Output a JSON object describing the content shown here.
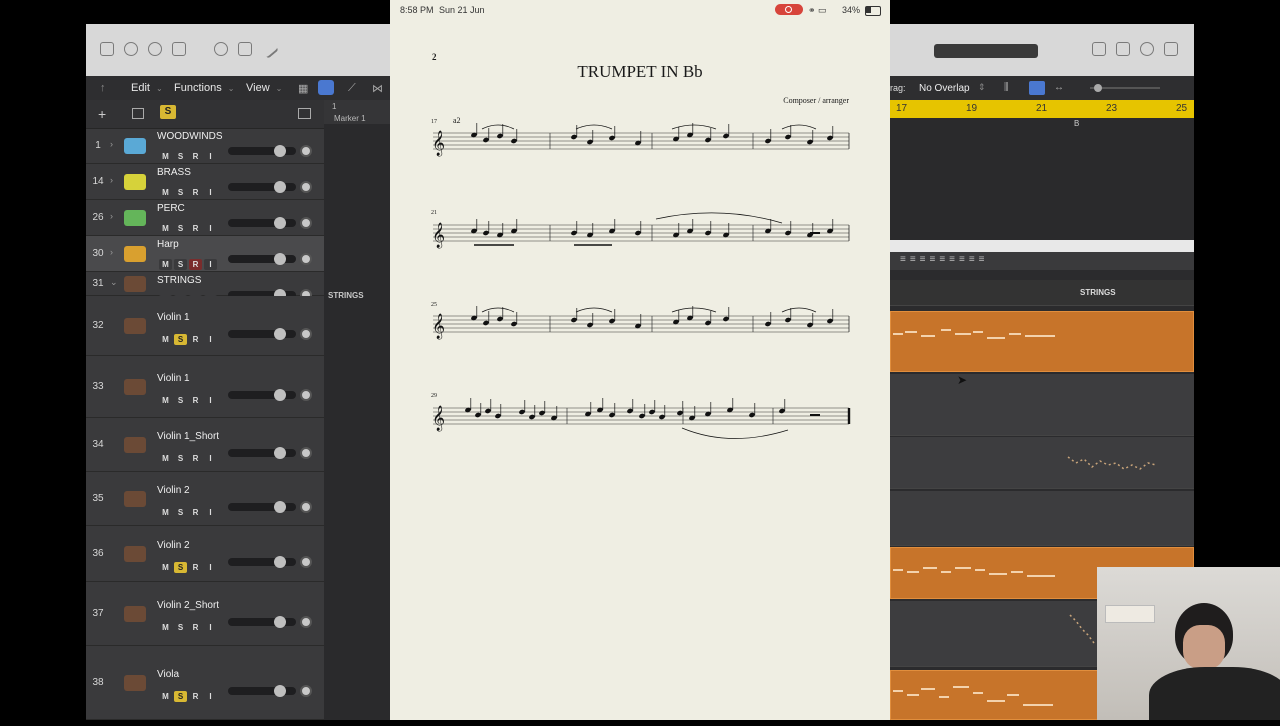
{
  "ipad_status": {
    "time": "8:58 PM",
    "date": "Sun 21 Jun",
    "battery": "34%"
  },
  "score": {
    "page_number": "2",
    "title": "TRUMPET IN Bb",
    "composer": "Composer / arranger",
    "systems": [
      {
        "measure": "17",
        "marking": "a2"
      },
      {
        "measure": "21"
      },
      {
        "measure": "25"
      },
      {
        "measure": "29"
      }
    ]
  },
  "logic": {
    "menus": {
      "edit": "Edit",
      "functions": "Functions",
      "view": "View"
    },
    "marker": "Marker 1",
    "drag_label": "rag:",
    "drag_value": "No Overlap",
    "ruler_numbers": [
      "17",
      "19",
      "21",
      "23",
      "25"
    ],
    "ruler_marker": "B",
    "folder_label": "STRINGS",
    "solo_badge": "S",
    "tracks": [
      {
        "num": "1",
        "name": "WOODWINDS",
        "m": "M",
        "s": "S",
        "r": "R",
        "i": "I",
        "color": "#5aa9d6"
      },
      {
        "num": "14",
        "name": "BRASS",
        "m": "M",
        "s": "S",
        "r": "R",
        "i": "I",
        "color": "#d6d23a"
      },
      {
        "num": "26",
        "name": "PERC",
        "m": "M",
        "s": "S",
        "r": "R",
        "i": "I",
        "color": "#64b55a"
      },
      {
        "num": "30",
        "name": "Harp",
        "m": "M",
        "s": "S",
        "r": "R",
        "i": "I",
        "color": "#d9a02f"
      },
      {
        "num": "31",
        "name": "STRINGS",
        "m": "M",
        "s": "S",
        "r": "R",
        "i": "I",
        "color": "#6b4a36"
      },
      {
        "num": "32",
        "name": "Violin 1",
        "m": "M",
        "s": "S",
        "r": "R",
        "i": "I",
        "color": "#6b4a36"
      },
      {
        "num": "33",
        "name": "Violin 1",
        "m": "M",
        "s": "S",
        "r": "R",
        "i": "I",
        "color": "#6b4a36"
      },
      {
        "num": "34",
        "name": "Violin 1_Short",
        "m": "M",
        "s": "S",
        "r": "R",
        "i": "I",
        "color": "#6b4a36"
      },
      {
        "num": "35",
        "name": "Violin 2",
        "m": "M",
        "s": "S",
        "r": "R",
        "i": "I",
        "color": "#6b4a36"
      },
      {
        "num": "36",
        "name": "Violin 2",
        "m": "M",
        "s": "S",
        "r": "R",
        "i": "I",
        "color": "#6b4a36"
      },
      {
        "num": "37",
        "name": "Violin 2_Short",
        "m": "M",
        "s": "S",
        "r": "R",
        "i": "I",
        "color": "#6b4a36"
      },
      {
        "num": "38",
        "name": "Viola",
        "m": "M",
        "s": "S",
        "r": "R",
        "i": "I",
        "color": "#6b4a36"
      }
    ]
  }
}
